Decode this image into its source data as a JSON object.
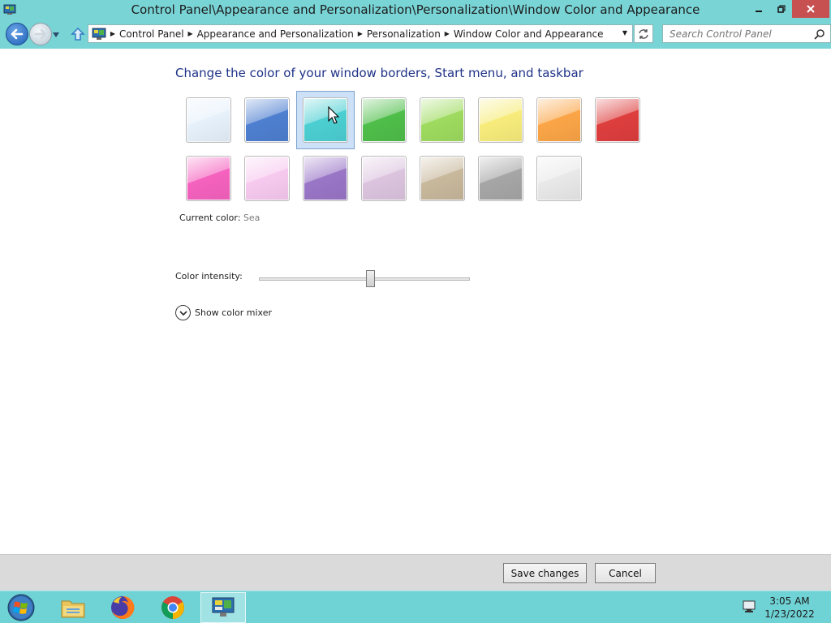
{
  "window": {
    "title": "Control Panel\\Appearance and Personalization\\Personalization\\Window Color and Appearance"
  },
  "address": {
    "crumbs": [
      "Control Panel",
      "Appearance and Personalization",
      "Personalization",
      "Window Color and Appearance"
    ]
  },
  "search": {
    "placeholder": "Search Control Panel"
  },
  "content": {
    "heading": "Change the color of your window borders, Start menu, and taskbar",
    "current_color_label": "Current color:",
    "current_color_value": "Sea",
    "intensity_label": "Color intensity:",
    "intensity_value": 0.53,
    "mixer_label": "Show color mixer",
    "swatches": [
      {
        "name": "sky",
        "color": "#e6f1fb",
        "selected": false
      },
      {
        "name": "twilight",
        "color": "#4e7fd0",
        "selected": false
      },
      {
        "name": "sea",
        "color": "#4ccfd2",
        "selected": true
      },
      {
        "name": "leaf",
        "color": "#4fbe4a",
        "selected": false
      },
      {
        "name": "lime",
        "color": "#9edb5f",
        "selected": false
      },
      {
        "name": "sun",
        "color": "#f7ec7b",
        "selected": false
      },
      {
        "name": "pumpkin",
        "color": "#fba547",
        "selected": false
      },
      {
        "name": "ruby",
        "color": "#de3e3e",
        "selected": false
      },
      {
        "name": "fuchsia",
        "color": "#f562bf",
        "selected": false
      },
      {
        "name": "blush",
        "color": "#f7c9ef",
        "selected": false
      },
      {
        "name": "violet",
        "color": "#9a76c7",
        "selected": false
      },
      {
        "name": "lavender",
        "color": "#dcc4df",
        "selected": false
      },
      {
        "name": "taupe",
        "color": "#c8b89c",
        "selected": false
      },
      {
        "name": "chocolate",
        "color": "#a6a6a6",
        "selected": false
      },
      {
        "name": "slate",
        "color": "#e9e9e9",
        "selected": false
      }
    ]
  },
  "buttons": {
    "save": "Save changes",
    "cancel": "Cancel"
  },
  "taskbar": {
    "items": [
      "start",
      "file-explorer",
      "firefox",
      "chrome",
      "control-panel"
    ],
    "time": "3:05 AM",
    "date": "1/23/2022"
  },
  "colors": {
    "accent": "#79d4d6",
    "heading": "#1e3287"
  }
}
